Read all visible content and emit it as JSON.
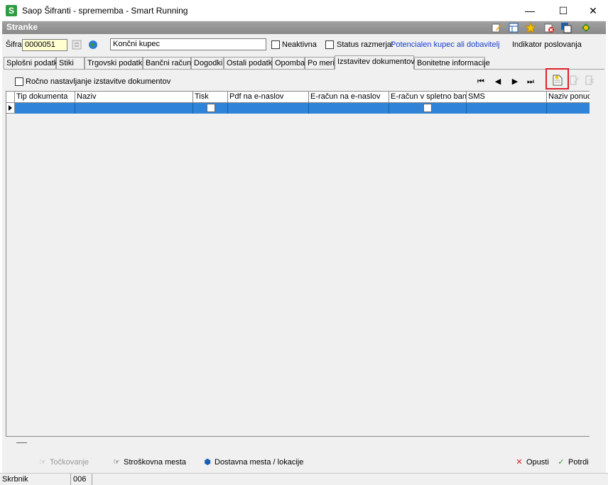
{
  "window": {
    "title": "Saop Šifranti - sprememba - Smart Running",
    "app_icon_letter": "S",
    "min_glyph": "—",
    "max_glyph": "☐",
    "close_glyph": "✕"
  },
  "header": {
    "title": "Stranke",
    "icons": [
      "edit-icon",
      "table-icon",
      "star-icon",
      "delete-icon",
      "copy-icon",
      "exit-icon"
    ]
  },
  "form": {
    "sifra_label": "Šifra",
    "sifra_value": "0000051",
    "name_value": "Končni kupec",
    "neaktivna_label": "Neaktivna",
    "status_label": "Status razmerja:",
    "status_value": "Potencialen kupec ali dobavitelj",
    "indikator_label": "Indikator poslovanja"
  },
  "tabs": [
    {
      "label": "Splošni podatki"
    },
    {
      "label": "Stiki"
    },
    {
      "label": "Trgovski podatki"
    },
    {
      "label": "Bančni računi"
    },
    {
      "label": "Dogodki"
    },
    {
      "label": "Ostali podatki"
    },
    {
      "label": "Opomba"
    },
    {
      "label": "Po meri"
    },
    {
      "label": "Izstavitev dokumentov",
      "active": true
    },
    {
      "label": "Bonitetne informacije"
    }
  ],
  "options": {
    "rocno_label": "Ročno nastavljanje izstavitve dokumentov"
  },
  "nav": {
    "first": "⏮",
    "prev": "◀",
    "next": "▶",
    "last": "⏭"
  },
  "grid": {
    "columns": [
      "Tip dokumenta",
      "Naziv",
      "Tisk",
      "Pdf na e-naslov",
      "E-račun na e-naslov",
      "E-račun v spletno banko",
      "SMS",
      "Naziv ponudnik"
    ]
  },
  "bottom": {
    "tockovanje": "Točkovanje",
    "stroskovna": "Stroškovna mesta",
    "dostavna": "Dostavna mesta / lokacije",
    "opusti": "Opusti",
    "potrdi": "Potrdi"
  },
  "status": {
    "user": "Skrbnik",
    "code": "006"
  }
}
